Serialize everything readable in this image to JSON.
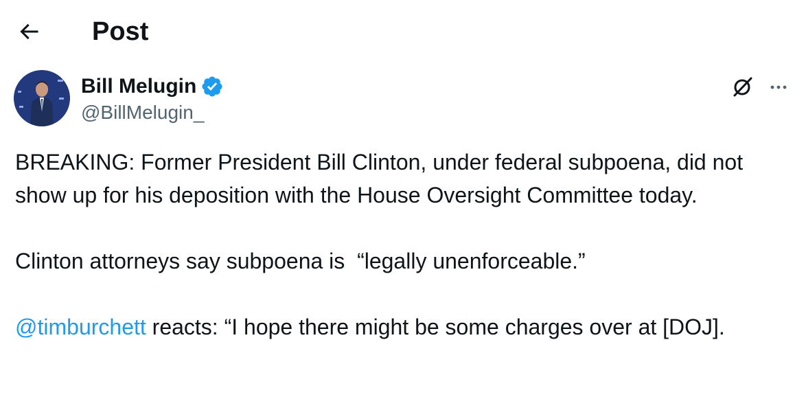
{
  "header": {
    "title": "Post",
    "back_icon": "arrow-left-icon"
  },
  "author": {
    "name": "Bill Melugin",
    "handle": "@BillMelugin_",
    "verified": true,
    "verified_icon": "verified-badge-icon",
    "avatar_icon": "avatar-photo"
  },
  "actions": {
    "grok_icon": "grok-icon",
    "more_icon": "more-options-icon"
  },
  "post": {
    "paragraph1": "BREAKING: Former President Bill Clinton, under federal subpoena, did not show up for his deposition with the House Oversight Committee today.",
    "paragraph2": "Clinton attorneys say subpoena is  “legally unenforceable.”",
    "mention": "@timburchett",
    "paragraph3_rest": " reacts: “I hope there might be some charges over at [DOJ]."
  },
  "colors": {
    "accent": "#1d9bf0",
    "text": "#0f1419",
    "muted": "#536471",
    "background": "#ffffff"
  }
}
